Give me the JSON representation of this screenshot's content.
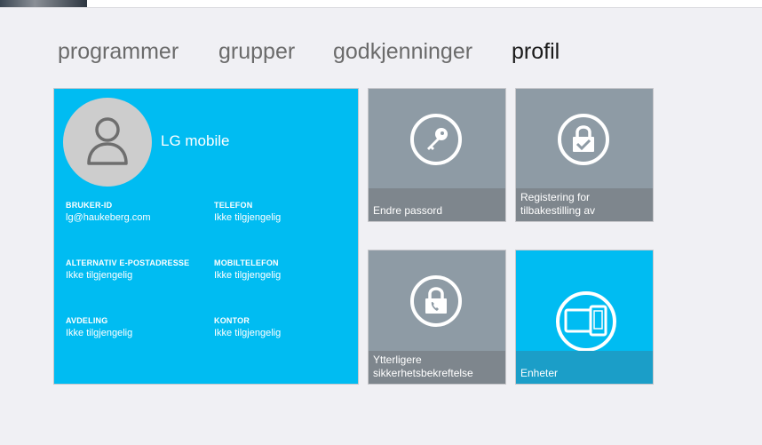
{
  "nav": {
    "tabs": [
      {
        "label": "programmer",
        "active": false
      },
      {
        "label": "grupper",
        "active": false
      },
      {
        "label": "godkjenninger",
        "active": false
      },
      {
        "label": "profil",
        "active": true
      }
    ]
  },
  "profile": {
    "name": "LG mobile",
    "avatar_icon": "user-icon",
    "fields": {
      "user_id": {
        "label": "BRUKER-ID",
        "value": "lg@haukeberg.com"
      },
      "phone": {
        "label": "TELEFON",
        "value": "Ikke tilgjengelig"
      },
      "alt_email": {
        "label": "ALTERNATIV E-POSTADRESSE",
        "value": "Ikke tilgjengelig"
      },
      "mobile": {
        "label": "MOBILTELEFON",
        "value": "Ikke tilgjengelig"
      },
      "department": {
        "label": "AVDELING",
        "value": "Ikke tilgjengelig"
      },
      "office": {
        "label": "KONTOR",
        "value": "Ikke tilgjengelig"
      }
    }
  },
  "tiles": {
    "change_password": {
      "label": "Endre passord",
      "icon": "key-icon"
    },
    "reset_registration": {
      "label": "Registering for tilbakestilling av",
      "icon": "lock-check-icon"
    },
    "additional_verification": {
      "label": "Ytterligere sikkerhetsbekreftelse",
      "icon": "lock-phone-icon"
    },
    "devices": {
      "label": "Enheter",
      "icon": "devices-icon"
    }
  },
  "colors": {
    "accent": "#00bcf2",
    "tile_gray": "#8e9ba5",
    "caption_gray": "#7e868d",
    "caption_blue": "#1b9ec8",
    "background": "#f0f0f4"
  }
}
